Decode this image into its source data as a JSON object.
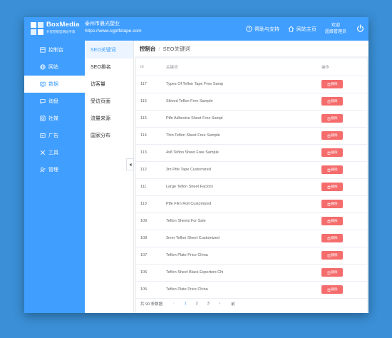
{
  "app": {
    "logo_text": "BoxMedia",
    "logo_sub": "外贸营销型网站专家",
    "company_name": "泰州市晨光塑业",
    "company_url": "https://www.cgptfetape.com"
  },
  "topbar": {
    "help_label": "帮助与支持",
    "site_home_label": "网站主页",
    "greeting": "欢迎",
    "role": "超级管理员"
  },
  "sidebar": {
    "items": [
      {
        "label": "控制台",
        "icon": "dashboard-icon"
      },
      {
        "label": "网站",
        "icon": "globe-icon"
      },
      {
        "label": "数据",
        "icon": "chart-icon"
      },
      {
        "label": "询盘",
        "icon": "inquiry-icon"
      },
      {
        "label": "社媒",
        "icon": "social-icon"
      },
      {
        "label": "广告",
        "icon": "ad-icon"
      },
      {
        "label": "工具",
        "icon": "tools-icon"
      },
      {
        "label": "管理",
        "icon": "manage-icon"
      }
    ]
  },
  "subnav": {
    "items": [
      {
        "label": "SEO关键词"
      },
      {
        "label": "SEO排名"
      },
      {
        "label": "访客量"
      },
      {
        "label": "受访页面"
      },
      {
        "label": "流量来源"
      },
      {
        "label": "国家分布"
      }
    ]
  },
  "breadcrumb": {
    "home": "控制台",
    "separator": "/",
    "current": "SEO关键词"
  },
  "table": {
    "headers": {
      "id": "Id",
      "keyword": "关键词",
      "actions": "操作"
    },
    "delete_label": "删除",
    "rows": [
      {
        "id": "117",
        "keyword": "Types Of Teflon Tape Free Samp"
      },
      {
        "id": "116",
        "keyword": "Skived Teflon Free Sample"
      },
      {
        "id": "115",
        "keyword": "Ptfe Adhesive Sheet Free Sampl"
      },
      {
        "id": "114",
        "keyword": "Thin Teflon Sheet Free Sample"
      },
      {
        "id": "113",
        "keyword": "4x8 Teflon Sheet Free Sample"
      },
      {
        "id": "112",
        "keyword": "3m Ptfe Tape Customized"
      },
      {
        "id": "111",
        "keyword": "Large Teflon Sheet Factory"
      },
      {
        "id": "110",
        "keyword": "Ptfe Film Roll Customized"
      },
      {
        "id": "109",
        "keyword": "Teflon Sheets For Sale"
      },
      {
        "id": "108",
        "keyword": "3mm Teflon Sheet Customized"
      },
      {
        "id": "107",
        "keyword": "Teflon Plate Price China"
      },
      {
        "id": "106",
        "keyword": "Teflon Sheet Black Exporters Chi"
      },
      {
        "id": "105",
        "keyword": "Teflon Plate Price China"
      }
    ]
  },
  "pagination": {
    "total_text": "共 90 条数据",
    "prev": "‹",
    "pages": [
      "1",
      "2",
      "3"
    ],
    "next": "›",
    "goto": "前"
  },
  "colors": {
    "primary": "#409eff",
    "danger": "#f56c6c",
    "background": "#3a8fd6"
  }
}
